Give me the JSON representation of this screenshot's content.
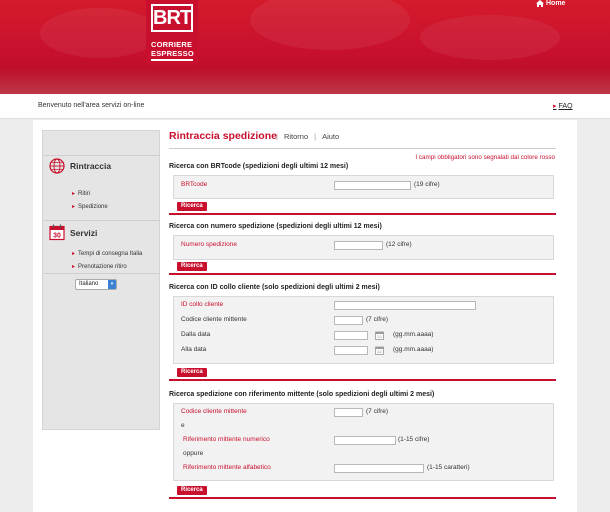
{
  "header": {
    "home_label": "Home",
    "logo": {
      "mark": "BRT",
      "line1": "CORRIERE",
      "line2": "ESPRESSO"
    }
  },
  "welcome": "Benvenuto  nell'area servizi on-line",
  "faq_label": "FAQ",
  "sidebar": {
    "sections": [
      {
        "title": "Rintraccia",
        "icon": "globe-icon",
        "items": [
          "Ritiri",
          "Spedizione"
        ]
      },
      {
        "title": "Servizi",
        "icon": "calendar-icon",
        "items": [
          "Tempi di consegna Italia",
          "Prenotazione ritiro"
        ]
      }
    ],
    "language": "Italiano"
  },
  "main": {
    "title": "Rintraccia spedizione",
    "nav": [
      "Ritorno",
      "Aiuto"
    ],
    "required_note": "I campi obbligatori sono segnalati dal colore rosso",
    "search_label": "Ricerca",
    "sections": [
      {
        "title": "Ricerca con BRTcode (spedizioni degli ultimi 12 mesi)",
        "fields": [
          {
            "label": "BRTcode",
            "hint": "(19 cifre)"
          }
        ]
      },
      {
        "title": "Ricerca con numero spedizione (spedizioni degli ultimi 12 mesi)",
        "fields": [
          {
            "label": "Numero spedizione",
            "hint": "(12 cifre)"
          }
        ]
      },
      {
        "title": "Ricerca con ID collo cliente (solo spedizioni degli ultimi 2 mesi)",
        "fields": [
          {
            "label": "ID collo cliente",
            "hint": ""
          },
          {
            "label": "Codice cliente mittente",
            "hint": "(7 cifre)"
          },
          {
            "label": "Dalla data",
            "hint": "(gg.mm.aaaa)"
          },
          {
            "label": "Alla data",
            "hint": "(gg.mm.aaaa)"
          }
        ]
      },
      {
        "title": "Ricerca spedizione con riferimento mittente (solo spedizioni degli ultimi 2 mesi)",
        "fields": [
          {
            "label": "Codice cliente mittente",
            "hint": "(7 cifre)"
          },
          {
            "label": "Riferimento mittente numerico",
            "hint": "(1-15 cifre)"
          },
          {
            "label": "Riferimento mittente alfabetico",
            "hint": "(1-15 caratteri)"
          }
        ],
        "connectors": [
          "e",
          "oppure"
        ]
      }
    ]
  },
  "colors": {
    "brand_red": "#c8102e",
    "sidebar_bg": "#e5e5e5",
    "box_bg": "#f2f2f2"
  }
}
